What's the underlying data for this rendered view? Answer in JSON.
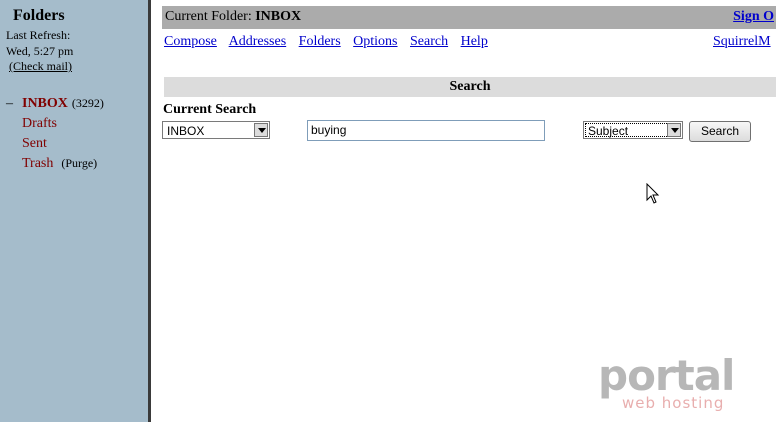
{
  "sidebar": {
    "title": "Folders",
    "last_refresh_label": "Last Refresh:",
    "last_refresh_time": "Wed, 5:27 pm",
    "check_mail": "(Check mail)",
    "folders": [
      {
        "dash": "–",
        "name": "INBOX",
        "count": "(3292)",
        "action": ""
      },
      {
        "dash": "",
        "name": "Drafts",
        "count": "",
        "action": ""
      },
      {
        "dash": "",
        "name": "Sent",
        "count": "",
        "action": ""
      },
      {
        "dash": "",
        "name": "Trash",
        "count": "",
        "action": "(Purge)"
      }
    ]
  },
  "header": {
    "current_folder_label": "Current Folder:",
    "current_folder_value": "INBOX",
    "sign_out": "Sign O"
  },
  "nav": {
    "items": [
      "Compose",
      "Addresses",
      "Folders",
      "Options",
      "Search",
      "Help"
    ],
    "brand_link": "SquirrelM"
  },
  "search": {
    "section_title": "Search",
    "current_search_label": "Current Search",
    "folder_select": "INBOX",
    "query": "buying",
    "field_select": "Subject",
    "button": "Search"
  },
  "watermark": {
    "word": "portal",
    "tagline": "web hosting"
  },
  "colors": {
    "sidebar_bg": "#a5bccb",
    "folder_link": "#800000",
    "nav_link": "#0000cc",
    "header_bar": "#ababab",
    "section_bar": "#dcdcdc"
  }
}
